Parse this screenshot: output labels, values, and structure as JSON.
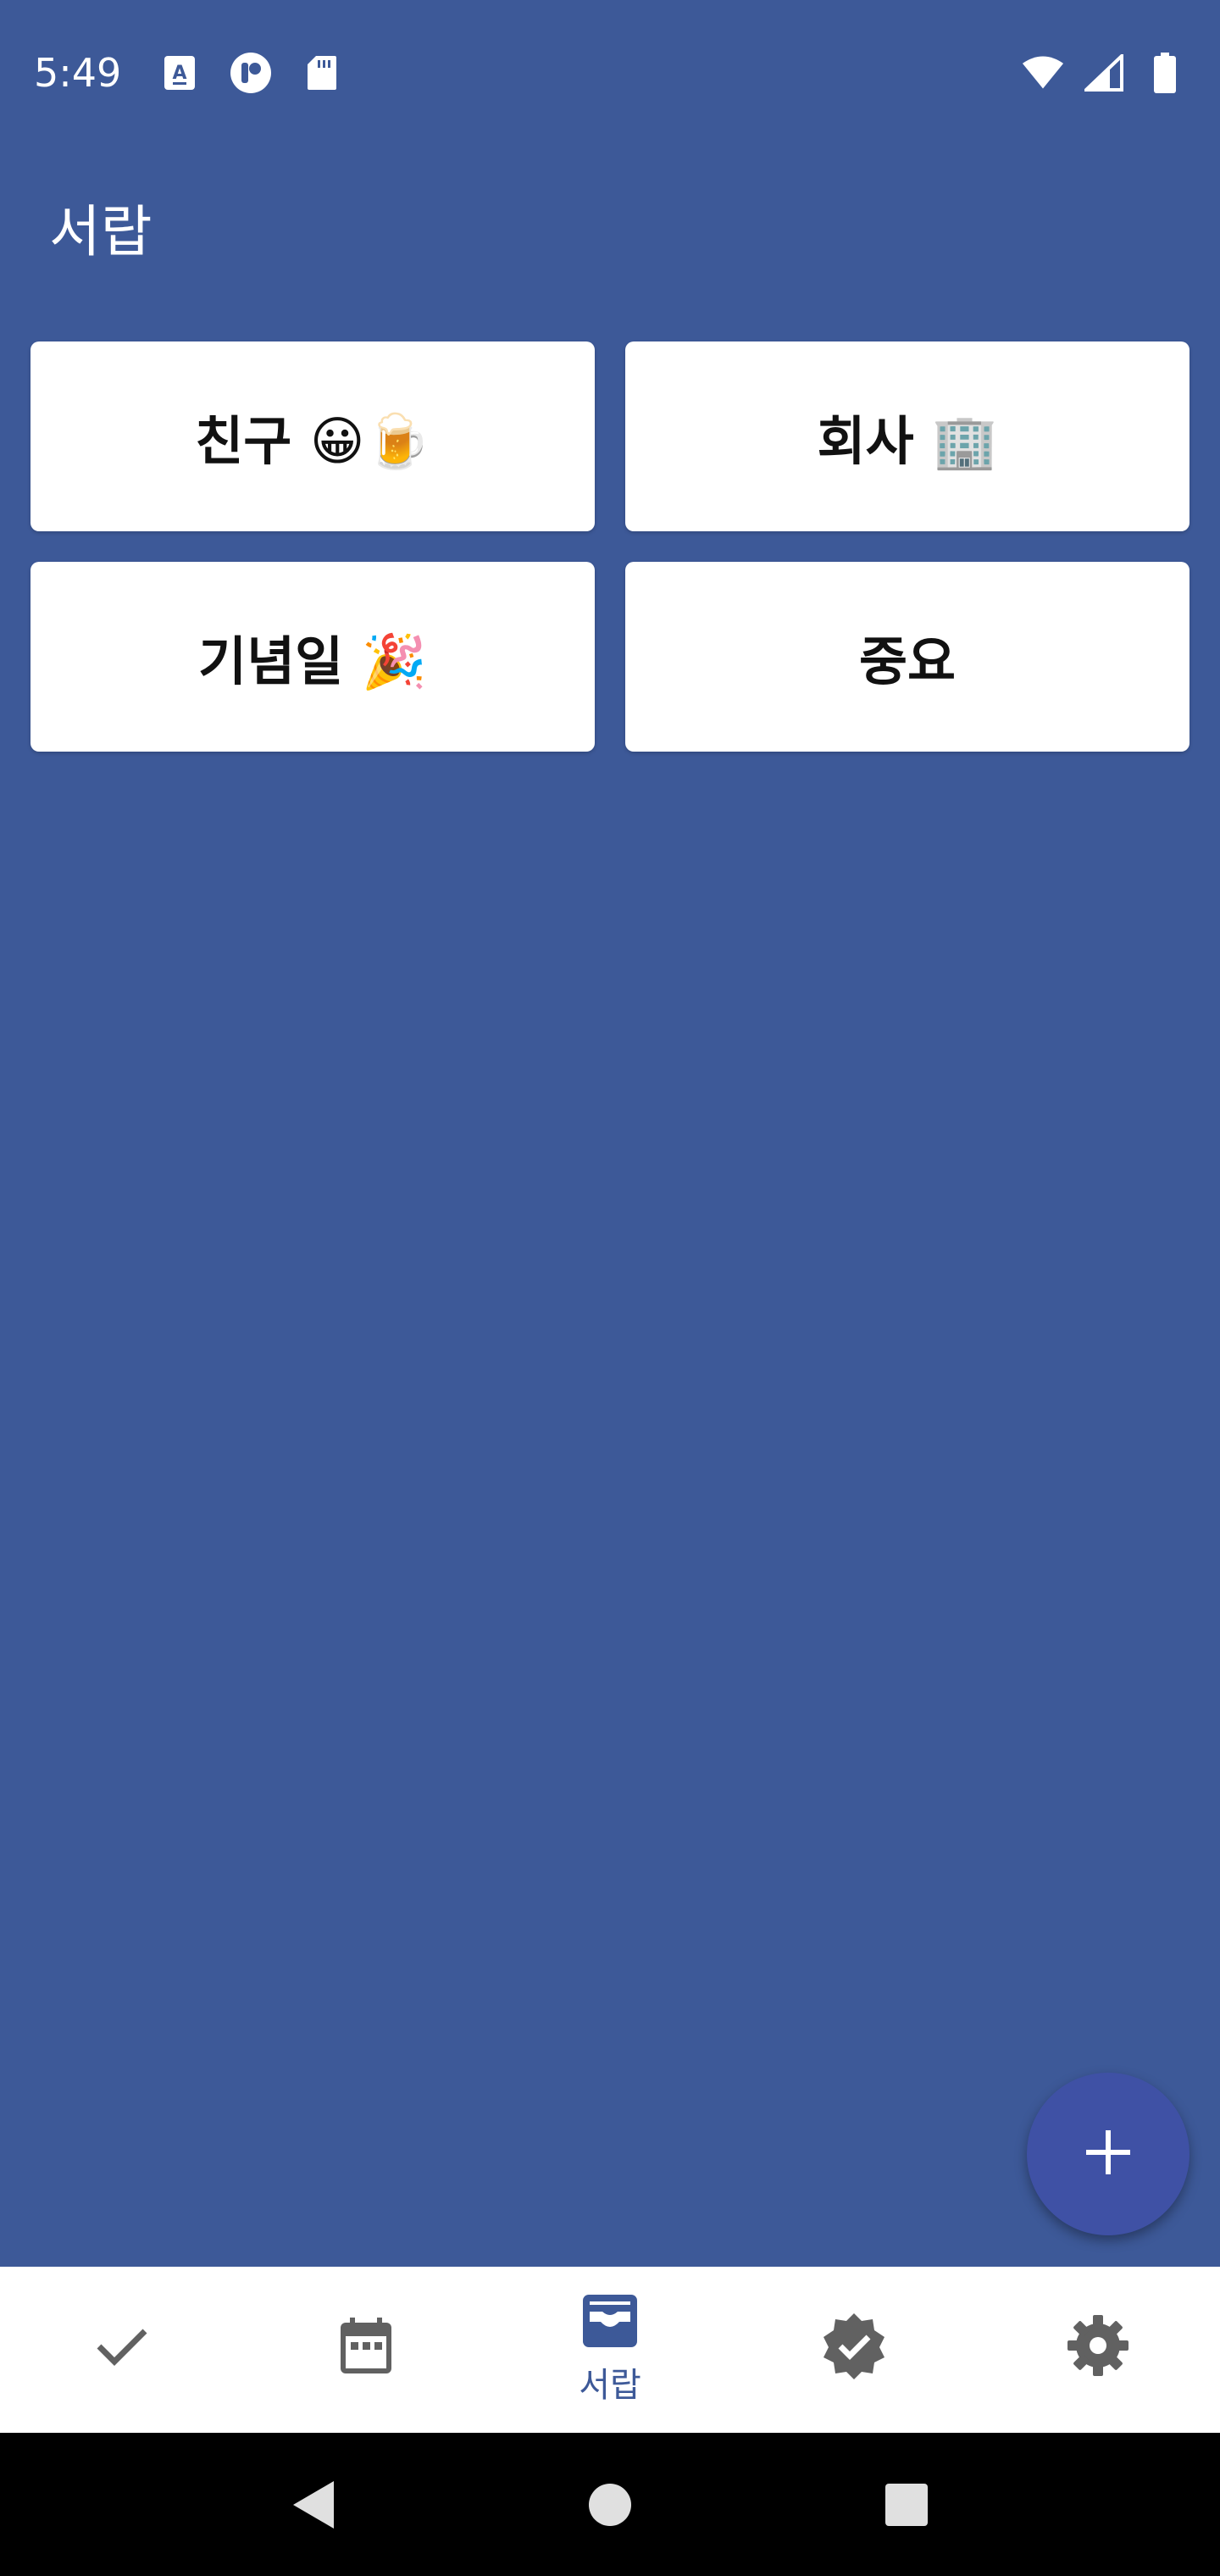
{
  "status_bar": {
    "time": "5:49",
    "icons_left": [
      "translate-icon",
      "app-notification-icon",
      "sd-card-icon"
    ],
    "icons_right": [
      "wifi-icon",
      "signal-icon",
      "battery-icon"
    ]
  },
  "page": {
    "title": "서랍"
  },
  "drawers": [
    {
      "label": "친구 😀🍺"
    },
    {
      "label": "회사 🏢"
    },
    {
      "label": "기념일 🎉"
    },
    {
      "label": "중요"
    }
  ],
  "fab": {
    "icon": "plus-icon"
  },
  "bottom_nav": {
    "items": [
      {
        "icon": "check-icon",
        "label": ""
      },
      {
        "icon": "calendar-icon",
        "label": ""
      },
      {
        "icon": "inbox-icon",
        "label": "서랍",
        "active": true
      },
      {
        "icon": "verified-icon",
        "label": ""
      },
      {
        "icon": "settings-icon",
        "label": ""
      }
    ]
  },
  "colors": {
    "background": "#3D5998",
    "fab": "#3F51A5",
    "active_nav": "#3D5998",
    "inactive_nav": "#616161"
  }
}
